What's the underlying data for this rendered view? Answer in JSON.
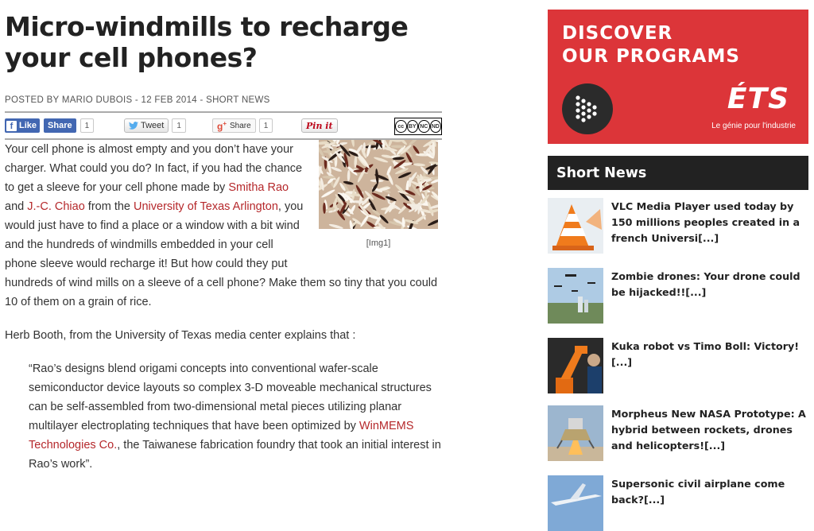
{
  "article": {
    "title": "Micro-windmills to recharge your cell phones?",
    "meta": {
      "posted_by": "POSTED BY",
      "author": "MARIO DUBOIS",
      "sep1": " - ",
      "date": "12 FEB 2014",
      "sep2": " - ",
      "category": "SHORT NEWS"
    },
    "share": {
      "fb_like": "Like",
      "fb_share": "Share",
      "fb_count": "1",
      "tweet": "Tweet",
      "tweet_count": "1",
      "gplus": "Share",
      "gplus_count": "1",
      "pin": "Pin it",
      "cc": [
        "cc",
        "BY",
        "NC",
        "ND"
      ]
    },
    "figure_caption": "[Img1]",
    "p1": [
      "Your cell phone is almost empty and you don’t have your charger. What could you do? In fact, if you had the chance to get a sleeve for your cell phone made by ",
      "Smitha Rao",
      " and ",
      "J.-C. Chiao",
      " from the ",
      "University of Texas Arlington",
      ", you would just have to find a place or a window with a bit wind and the hundreds of windmills embedded in your cell phone sleeve would recharge it! But how could they put hundreds of wind mills on a sleeve of a cell phone? Make them so tiny that you could 10 of them on a grain of rice."
    ],
    "p2": "Herb Booth, from the University of Texas media center explains that :",
    "quote": [
      "“Rao’s designs blend origami concepts into conventional wafer-scale semiconductor device layouts so complex 3-D moveable mechanical structures can be self-assembled from two-dimensional metal pieces utilizing planar multilayer electroplating techniques that have been optimized by ",
      "WinMEMS Technologies Co.",
      ", the Taiwanese fabrication foundry that took an initial interest in Rao’s work”."
    ]
  },
  "ad": {
    "line1": "DISCOVER",
    "line2": "OUR PROGRAMS",
    "logo": "ÉTS",
    "tagline": "Le génie pour l'industrie",
    "color": "#dc3539"
  },
  "sidebar": {
    "heading": "Short News",
    "items": [
      {
        "title": "VLC Media Player used today by 150 millions peoples created in a french Universi[...]",
        "thumb": "vlc-cone-thumbnail"
      },
      {
        "title": "Zombie drones: Your drone could be hijacked!![...]",
        "thumb": "drones-thumbnail"
      },
      {
        "title": "Kuka robot vs Timo Boll: Victory![...]",
        "thumb": "robot-arm-thumbnail"
      },
      {
        "title": "Morpheus New NASA Prototype: A hybrid between rockets, drones and helicopters![...]",
        "thumb": "lander-thumbnail"
      },
      {
        "title": "Supersonic civil airplane come back?[...]",
        "thumb": "airplane-thumbnail"
      }
    ]
  }
}
